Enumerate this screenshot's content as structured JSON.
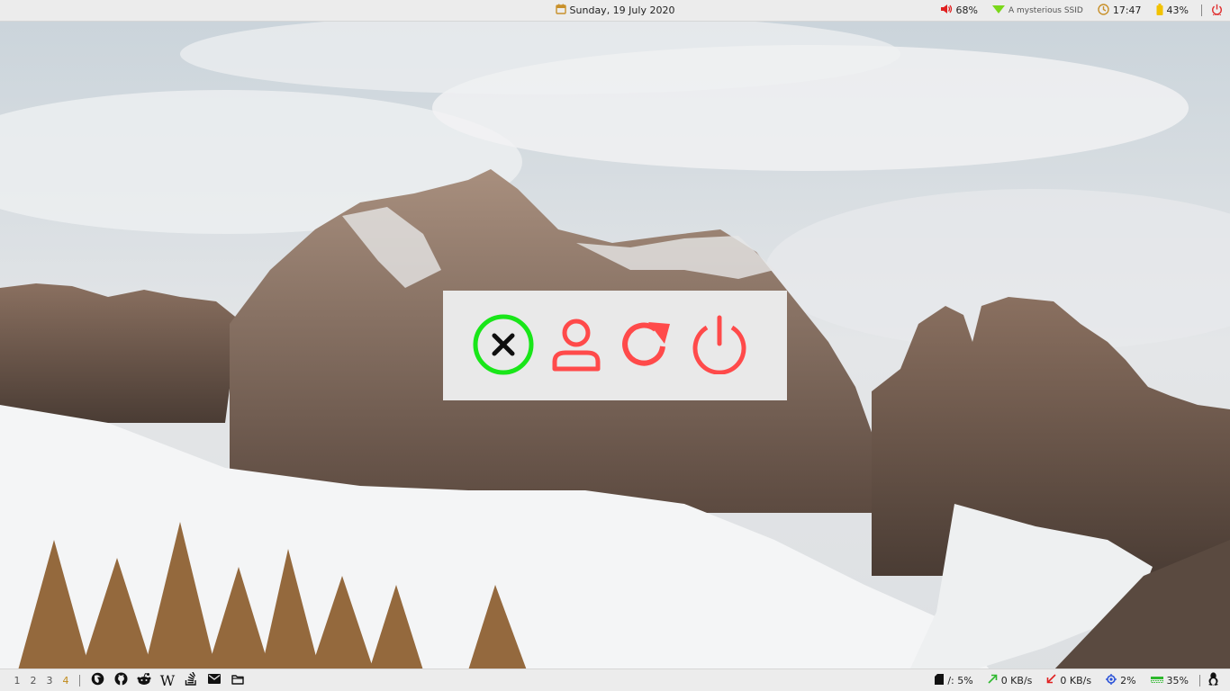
{
  "topbar": {
    "date": "Sunday, 19 July 2020",
    "volume": "68%",
    "ssid": "A mysterious SSID",
    "time": "17:47",
    "battery": "43%",
    "icons": {
      "calendar": "calendar-icon",
      "volume": "speaker-icon",
      "wifi": "wifi-icon",
      "clock": "clock-icon",
      "battery": "battery-icon",
      "power": "power-icon"
    }
  },
  "power_menu": {
    "buttons": [
      {
        "name": "cancel",
        "icon": "close-circle-icon",
        "color": "#19e619"
      },
      {
        "name": "logout",
        "icon": "user-icon",
        "color": "#ff4a4a"
      },
      {
        "name": "reboot",
        "icon": "reboot-icon",
        "color": "#ff4a4a"
      },
      {
        "name": "shutdown",
        "icon": "power-icon",
        "color": "#ff4a4a"
      }
    ]
  },
  "bottombar": {
    "workspaces": [
      "1",
      "2",
      "3",
      "4"
    ],
    "active_workspace": "4",
    "launchers": [
      "firefox-icon",
      "github-icon",
      "reddit-icon",
      "wikipedia-icon",
      "stack-overflow-icon",
      "mail-icon",
      "folder-icon"
    ],
    "disk": "/: 5%",
    "upload": "0 KB/s",
    "download": "0 KB/s",
    "cpu": "2%",
    "memory": "35%"
  },
  "colors": {
    "accent_active_workspace": "#c08a1a",
    "cancel_green": "#19e619",
    "action_red": "#ff4a4a",
    "bar_background": "#ececec"
  }
}
